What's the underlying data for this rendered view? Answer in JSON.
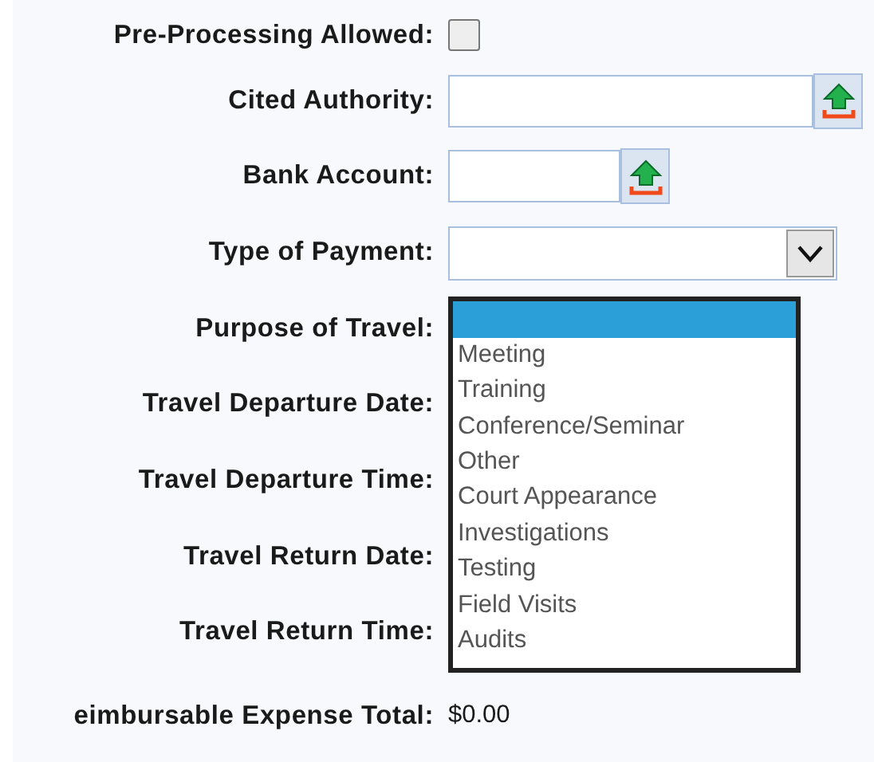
{
  "form": {
    "rows": [
      {
        "kind": "checkbox",
        "label": "Pre-Processing Allowed:",
        "checked": false
      },
      {
        "kind": "lookup",
        "label": "Cited Authority:"
      },
      {
        "kind": "short_lookup",
        "label": "Bank Account:"
      },
      {
        "kind": "select",
        "label": "Type of Payment:"
      },
      {
        "kind": "open_select",
        "label": "Purpose of Travel:",
        "options": [
          {
            "selected": true
          },
          {
            "label": "Meeting",
            "selected": false
          },
          {
            "label": "Training",
            "selected": false
          },
          {
            "label": "Conference/Seminar",
            "selected": false
          },
          {
            "label": "Other",
            "selected": false
          },
          {
            "label": "Court Appearance",
            "selected": false
          },
          {
            "label": "Investigations",
            "selected": false
          },
          {
            "label": "Testing",
            "selected": false
          },
          {
            "label": "Field Visits",
            "selected": false
          },
          {
            "label": "Audits",
            "selected": false
          }
        ]
      },
      {
        "kind": "covered",
        "label": "Travel Departure Date:"
      },
      {
        "kind": "covered",
        "label": "Travel Departure Time:"
      },
      {
        "kind": "covered",
        "label": "Travel Return Date:"
      },
      {
        "kind": "covered",
        "label": "Travel Return Time:"
      },
      {
        "kind": "value",
        "label": "eimbursable Expense Total:",
        "value": "$0.00"
      }
    ]
  }
}
